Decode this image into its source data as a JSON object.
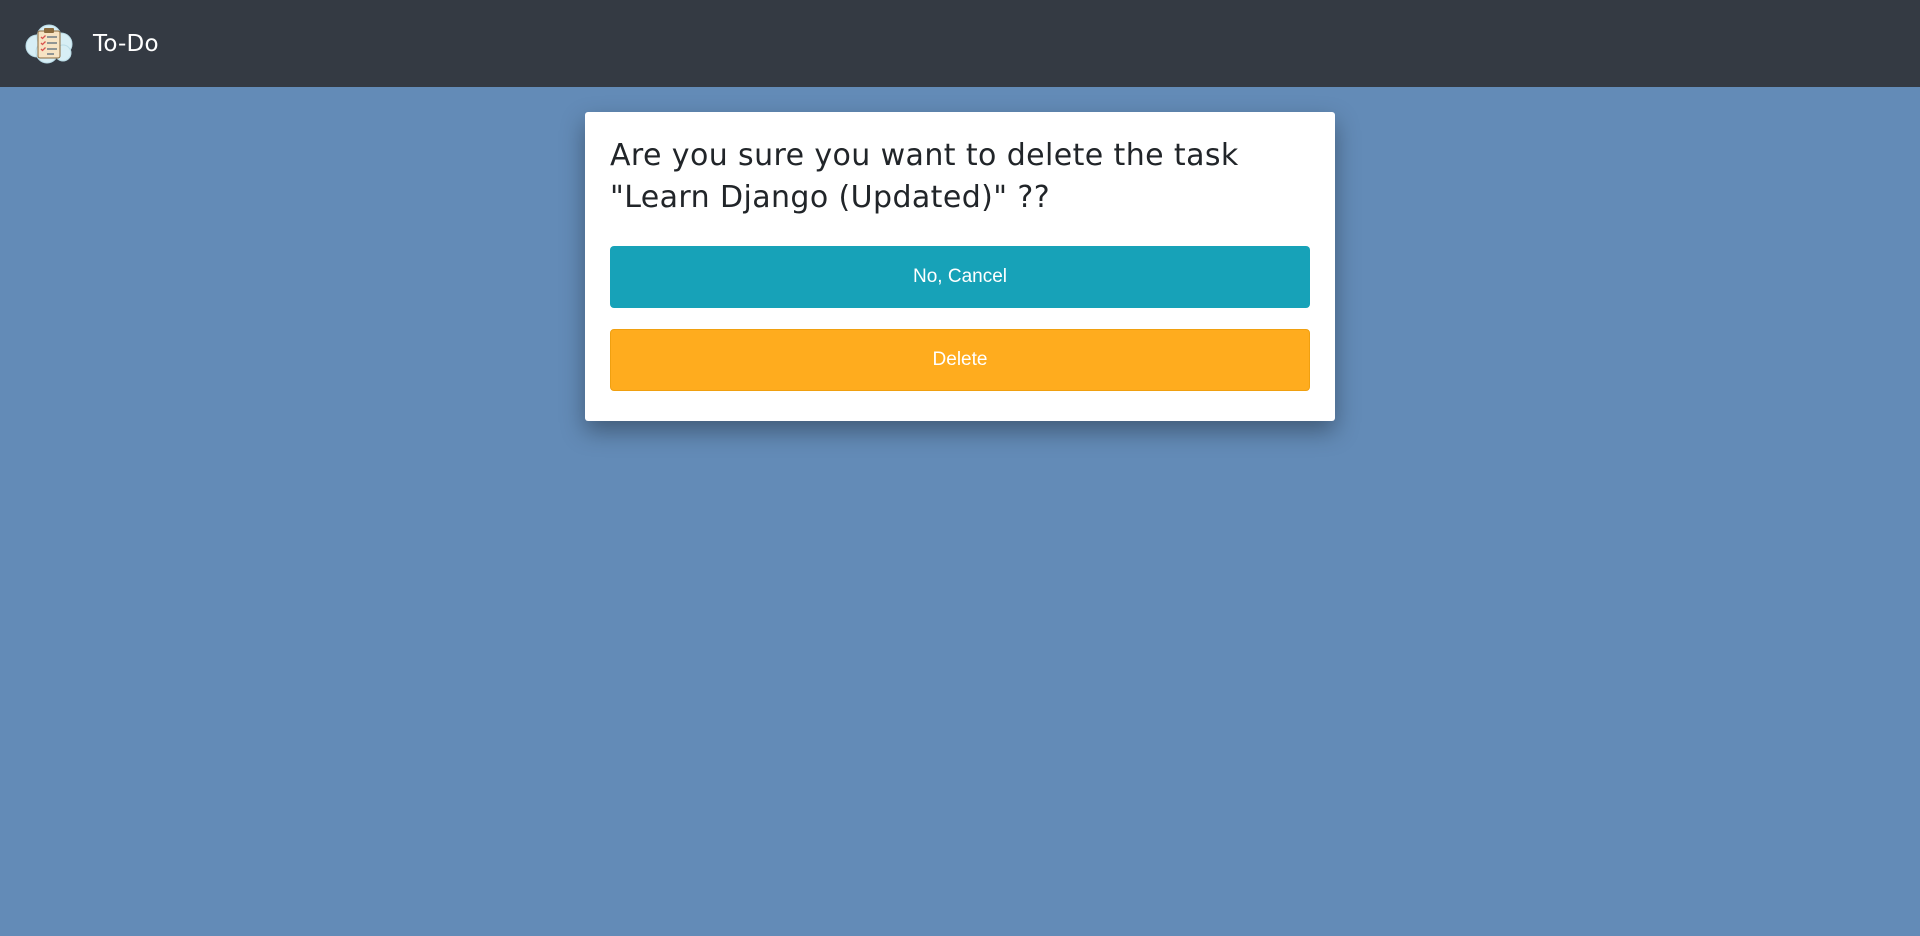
{
  "navbar": {
    "logo_icon": "todo-list-cloud-icon",
    "brand_title": "To-Do"
  },
  "confirm_dialog": {
    "heading": "Are you sure you want to delete the task \"Learn Django (Updated)\" ??",
    "cancel_label": "No, Cancel",
    "delete_label": "Delete"
  },
  "colors": {
    "navbar_bg": "#343a43",
    "page_bg": "#638bb7",
    "cancel_button": "#17a2b8",
    "delete_button": "#ffac1e"
  }
}
